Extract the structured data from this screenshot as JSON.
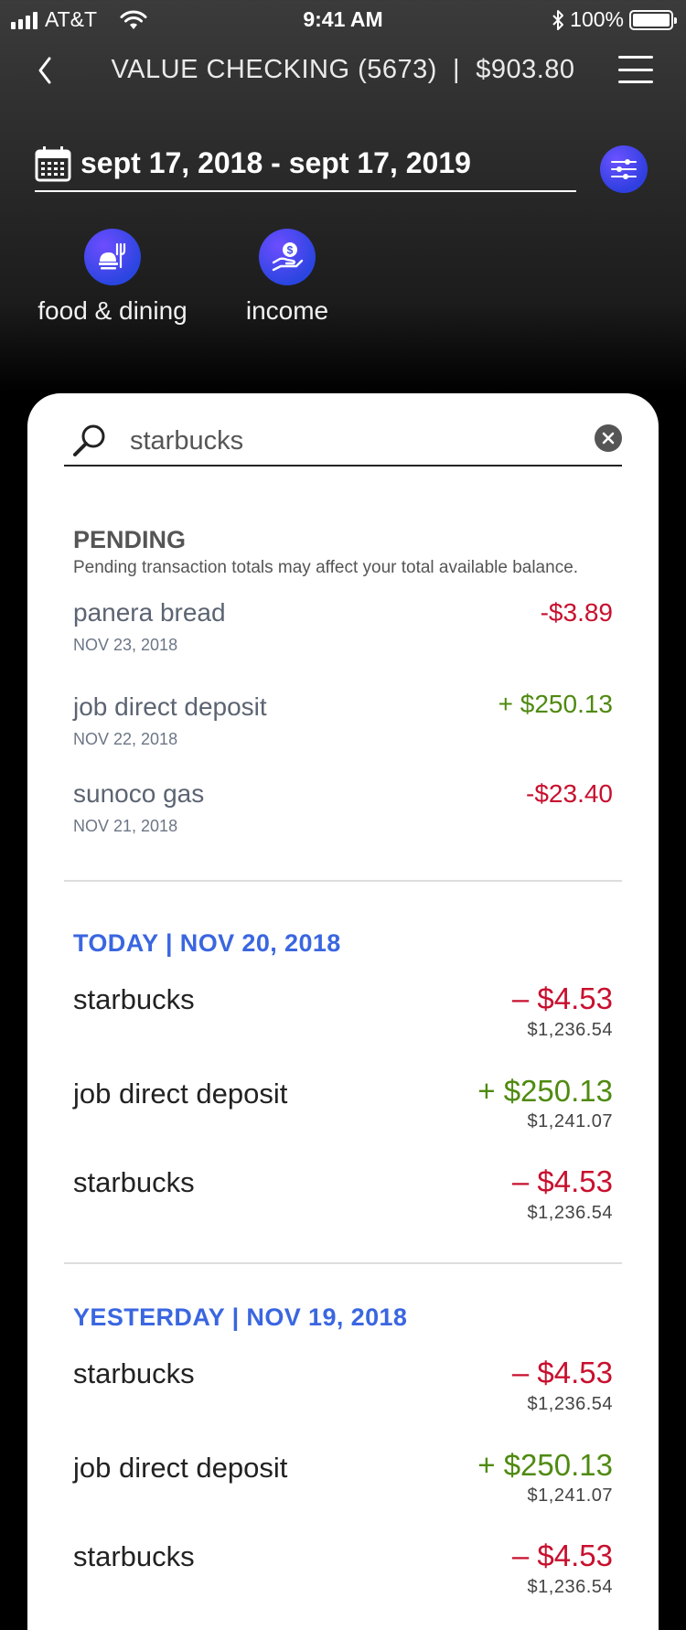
{
  "status_bar": {
    "carrier": "AT&T",
    "time": "9:41 AM",
    "battery": "100%"
  },
  "nav": {
    "title": "VALUE CHECKING (5673)  |  $903.80"
  },
  "date_range": {
    "label": "sept 17, 2018 - sept 17, 2019"
  },
  "categories": [
    {
      "label": "food & dining",
      "icon": "food-dining-icon"
    },
    {
      "label": "income",
      "icon": "income-icon"
    }
  ],
  "search": {
    "value": "starbucks"
  },
  "pending": {
    "title": "PENDING",
    "note": "Pending transaction totals may affect your total available balance.",
    "items": [
      {
        "name": "panera bread",
        "date": "NOV 23, 2018",
        "amount": "-$3.89"
      },
      {
        "name": "job direct deposit",
        "date": "NOV 22, 2018",
        "amount": "+ $250.13"
      },
      {
        "name": "sunoco gas",
        "date": "NOV 21, 2018",
        "amount": "-$23.40"
      }
    ]
  },
  "sections": [
    {
      "heading": "TODAY  |  NOV 20, 2018",
      "items": [
        {
          "name": "starbucks",
          "amount": "– $4.53",
          "balance": "$1,236.54"
        },
        {
          "name": "job direct deposit",
          "amount": "+ $250.13",
          "balance": "$1,241.07"
        },
        {
          "name": "starbucks",
          "amount": "– $4.53",
          "balance": "$1,236.54"
        }
      ]
    },
    {
      "heading": "YESTERDAY  |  NOV 19, 2018",
      "items": [
        {
          "name": "starbucks",
          "amount": "– $4.53",
          "balance": "$1,236.54"
        },
        {
          "name": "job direct deposit",
          "amount": "+ $250.13",
          "balance": "$1,241.07"
        },
        {
          "name": "starbucks",
          "amount": "– $4.53",
          "balance": "$1,236.54"
        }
      ]
    }
  ],
  "colors": {
    "negative": "#c8102e",
    "positive": "#4f8a10",
    "section_heading": "#3a66e0",
    "accent_gradient_start": "#6d4dff",
    "accent_gradient_end": "#2a45e0"
  }
}
